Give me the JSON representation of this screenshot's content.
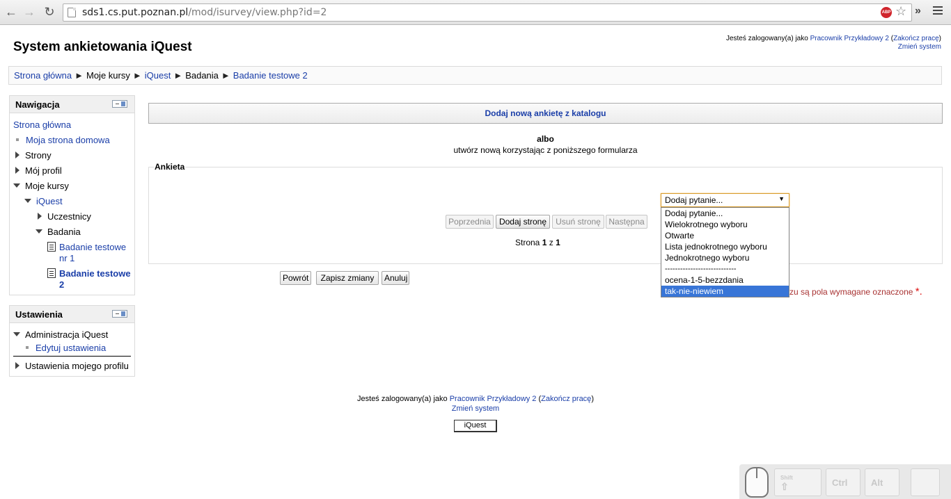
{
  "browser": {
    "url_host": "sds1.cs.put.poznan.pl",
    "url_path": "/mod/isurvey/view.php?id=2",
    "adblock_label": "ABP"
  },
  "header": {
    "site_title": "System ankietowania iQuest",
    "login_prefix": "Jesteś zalogowany(a) jako",
    "user_name": "Pracownik Przykładowy 2",
    "logout_link": "Zakończ pracę",
    "change_system": "Zmień system"
  },
  "breadcrumb": {
    "items": [
      "Strona główna",
      "Moje kursy",
      "iQuest",
      "Badania",
      "Badanie testowe 2"
    ],
    "separator": "►"
  },
  "navigation_block": {
    "title": "Nawigacja",
    "items": [
      "Strona główna",
      "Moja strona domowa",
      "Strony",
      "Mój profil",
      "Moje kursy",
      "iQuest",
      "Uczestnicy",
      "Badania",
      "Badanie testowe nr 1",
      "Badanie testowe 2"
    ]
  },
  "settings_block": {
    "title": "Ustawienia",
    "items": [
      "Administracja iQuest",
      "Edytuj ustawienia",
      "Ustawienia mojego profilu"
    ]
  },
  "main": {
    "catalog_button": "Dodaj nową ankietę z katalogu",
    "or_label": "albo",
    "or_sub": "utwórz nową korzystając z poniższego formularza",
    "fieldset_legend": "Ankieta",
    "page_buttons": [
      "Poprzednia",
      "Dodaj stronę",
      "Usuń stronę",
      "Następna"
    ],
    "page_label": "Strona",
    "page_current": "1",
    "page_of": "z",
    "page_total": "1",
    "question_select": {
      "selected": "Dodaj pytanie...",
      "options": [
        "Dodaj pytanie...",
        "Wielokrotnego wyboru",
        "Otwarte",
        "Lista jednokrotnego wyboru",
        "Jednokrotnego wyboru",
        "----------------------------",
        "ocena-1-5-bezzdania",
        "tak-nie-niewiem"
      ],
      "highlighted_index": 7
    },
    "form_buttons": [
      "Powrót",
      "Zapisz zmiany",
      "Anuluj"
    ],
    "required_note": "zu są pola wymagane oznaczone",
    "required_mark": "*."
  },
  "footer": {
    "login_prefix": "Jesteś zalogowany(a) jako",
    "user_name": "Pracownik Przykładowy 2",
    "logout_link": "Zakończ pracę",
    "change_system": "Zmień system",
    "home_button": "iQuest"
  },
  "overlay": {
    "keys": [
      "Shift",
      "Ctrl",
      "Alt"
    ]
  },
  "colors": {
    "link": "#1a3ea8",
    "selected_option": "#3875d7",
    "required_text": "#a83232"
  }
}
